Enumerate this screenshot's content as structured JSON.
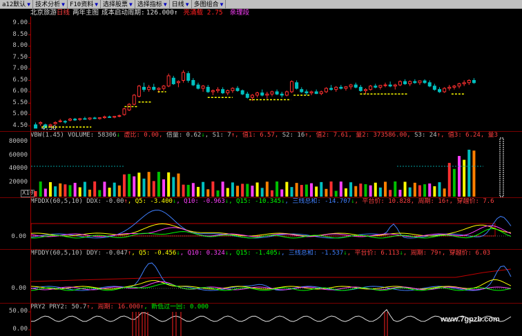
{
  "toolbar": {
    "items": [
      {
        "label": "a12默认"
      },
      {
        "label": "技术分析"
      },
      {
        "label": "F10资料"
      },
      {
        "label": "选择股票"
      },
      {
        "label": "选择指标"
      },
      {
        "label": "日线"
      },
      {
        "label": "多图组合"
      }
    ]
  },
  "info": {
    "stock_name": "北京旅游",
    "period": "日线",
    "ma_label": "两年主图",
    "cost_label": "成本启动周期:",
    "cost_value": "126.000↑",
    "red_text": "亮涌载 2.75",
    "magenta_text": "亲理段"
  },
  "main_chart": {
    "y_labels": [
      "9.00",
      "8.50",
      "8.00",
      "7.50",
      "7.00",
      "6.50",
      "6.00",
      "5.50",
      "5.00",
      "4.50"
    ],
    "low_marker": "4.30",
    "candles": [
      [
        4.55,
        4.65,
        4.45,
        4.4
      ],
      [
        4.6,
        4.7,
        4.5,
        4.65
      ],
      [
        4.55,
        4.6,
        4.4,
        4.42
      ],
      [
        4.5,
        4.6,
        4.45,
        4.55
      ],
      [
        4.6,
        4.7,
        4.55,
        4.65
      ],
      [
        4.7,
        4.8,
        4.65,
        4.72
      ],
      [
        4.7,
        4.75,
        4.6,
        4.68
      ],
      [
        4.75,
        4.85,
        4.7,
        4.8
      ],
      [
        4.8,
        4.85,
        4.72,
        4.76
      ],
      [
        4.78,
        4.85,
        4.72,
        4.82
      ],
      [
        4.82,
        4.9,
        4.78,
        4.8
      ],
      [
        4.8,
        4.88,
        4.75,
        4.85
      ],
      [
        4.85,
        4.9,
        4.8,
        4.82
      ],
      [
        4.82,
        4.88,
        4.78,
        4.86
      ],
      [
        4.86,
        4.95,
        4.82,
        4.9
      ],
      [
        4.9,
        4.95,
        4.85,
        4.88
      ],
      [
        4.88,
        4.94,
        4.84,
        4.92
      ],
      [
        4.92,
        5.0,
        4.88,
        4.95
      ],
      [
        5.0,
        5.3,
        4.95,
        5.25
      ],
      [
        5.2,
        5.5,
        5.15,
        5.45
      ],
      [
        5.45,
        5.9,
        5.4,
        5.85
      ],
      [
        5.8,
        6.3,
        5.75,
        6.25
      ],
      [
        6.2,
        6.4,
        6.0,
        6.1
      ],
      [
        6.1,
        6.3,
        6.0,
        6.2
      ],
      [
        6.2,
        6.35,
        6.05,
        6.1
      ],
      [
        6.1,
        6.2,
        5.95,
        6.15
      ],
      [
        6.15,
        6.3,
        6.05,
        6.25
      ],
      [
        6.25,
        6.8,
        6.2,
        6.7
      ],
      [
        6.6,
        6.7,
        6.3,
        6.35
      ],
      [
        6.4,
        6.5,
        6.2,
        6.45
      ],
      [
        6.5,
        6.95,
        6.4,
        6.85
      ],
      [
        6.8,
        6.9,
        6.4,
        6.5
      ],
      [
        6.5,
        6.6,
        6.25,
        6.3
      ],
      [
        6.3,
        6.4,
        6.1,
        6.15
      ],
      [
        6.15,
        6.3,
        6.0,
        6.25
      ],
      [
        6.2,
        6.3,
        5.95,
        6.0
      ],
      [
        6.0,
        6.1,
        5.85,
        6.05
      ],
      [
        6.05,
        6.2,
        5.95,
        6.1
      ],
      [
        6.1,
        6.2,
        5.9,
        5.95
      ],
      [
        5.95,
        6.1,
        5.85,
        6.05
      ],
      [
        6.05,
        6.2,
        5.95,
        6.15
      ],
      [
        6.15,
        6.25,
        6.0,
        6.05
      ],
      [
        6.05,
        6.1,
        5.85,
        5.9
      ],
      [
        5.9,
        6.0,
        5.7,
        5.75
      ],
      [
        5.75,
        5.9,
        5.6,
        5.85
      ],
      [
        5.85,
        6.0,
        5.75,
        5.95
      ],
      [
        5.95,
        6.1,
        5.8,
        5.85
      ],
      [
        5.85,
        6.0,
        5.7,
        5.9
      ],
      [
        5.9,
        6.05,
        5.8,
        6.0
      ],
      [
        6.0,
        6.1,
        5.85,
        5.9
      ],
      [
        5.9,
        6.0,
        5.75,
        5.85
      ],
      [
        5.85,
        6.05,
        5.8,
        6.0
      ],
      [
        6.0,
        6.5,
        5.95,
        6.45
      ],
      [
        6.4,
        6.5,
        6.1,
        6.15
      ],
      [
        6.1,
        6.2,
        5.95,
        6.0
      ],
      [
        6.0,
        6.1,
        5.85,
        5.95
      ],
      [
        5.95,
        6.05,
        5.85,
        6.0
      ],
      [
        6.0,
        6.1,
        5.9,
        5.92
      ],
      [
        5.92,
        6.05,
        5.85,
        6.0
      ],
      [
        6.0,
        6.2,
        5.95,
        6.15
      ],
      [
        6.15,
        6.3,
        6.05,
        6.1
      ],
      [
        6.1,
        6.25,
        6.0,
        6.2
      ],
      [
        6.2,
        6.3,
        6.1,
        6.15
      ],
      [
        6.15,
        6.25,
        6.05,
        6.22
      ],
      [
        6.22,
        6.35,
        6.1,
        6.3
      ],
      [
        6.3,
        6.4,
        6.15,
        6.2
      ],
      [
        6.2,
        6.3,
        6.0,
        6.05
      ],
      [
        6.05,
        6.15,
        5.9,
        6.1
      ],
      [
        6.1,
        6.3,
        6.05,
        6.25
      ],
      [
        6.25,
        6.35,
        6.15,
        6.2
      ],
      [
        6.2,
        6.3,
        6.1,
        6.28
      ],
      [
        6.28,
        6.4,
        6.2,
        6.3
      ],
      [
        6.3,
        6.45,
        6.2,
        6.25
      ],
      [
        6.25,
        6.35,
        6.1,
        6.3
      ],
      [
        6.3,
        6.5,
        6.25,
        6.45
      ],
      [
        6.45,
        6.55,
        6.3,
        6.35
      ],
      [
        6.35,
        6.5,
        6.25,
        6.45
      ],
      [
        6.45,
        6.55,
        6.35,
        6.4
      ],
      [
        6.4,
        6.5,
        6.3,
        6.48
      ],
      [
        6.48,
        6.55,
        6.35,
        6.4
      ],
      [
        6.4,
        6.5,
        6.2,
        6.25
      ],
      [
        6.25,
        6.35,
        6.05,
        6.1
      ],
      [
        6.1,
        6.2,
        5.95,
        6.0
      ],
      [
        6.0,
        6.2,
        5.95,
        6.15
      ],
      [
        6.15,
        6.3,
        6.05,
        6.2
      ],
      [
        6.2,
        6.3,
        6.1,
        6.25
      ],
      [
        6.25,
        6.4,
        6.15,
        6.35
      ],
      [
        6.35,
        6.5,
        6.25,
        6.4
      ],
      [
        6.4,
        6.55,
        6.3,
        6.5
      ],
      [
        6.5,
        6.6,
        6.35,
        6.4
      ]
    ],
    "support_lines": [
      {
        "x0": 0.03,
        "x1": 0.21,
        "y": 4.45
      },
      {
        "x0": 0.33,
        "x1": 0.38,
        "y": 5.35
      },
      {
        "x0": 0.38,
        "x1": 0.43,
        "y": 5.55
      },
      {
        "x0": 0.45,
        "x1": 0.48,
        "y": 6.0
      },
      {
        "x0": 0.63,
        "x1": 0.72,
        "y": 5.75
      },
      {
        "x0": 0.78,
        "x1": 0.93,
        "y": 5.65
      },
      {
        "x0": 0.94,
        "x1": 1.0,
        "y": 5.85
      },
      {
        "x0": 1.18,
        "x1": 1.35,
        "y": 5.9
      },
      {
        "x0": 1.51,
        "x1": 1.56,
        "y": 5.9
      }
    ]
  },
  "volume_panel": {
    "header": [
      {
        "t": "VBW(1.45) VOLUME: 58306",
        "c": "#c0c0c0"
      },
      {
        "t": "↓",
        "c": "#00c000"
      },
      {
        "t": " 虚比: 0.00,",
        "c": "#ff4040"
      },
      {
        "t": " 倍量: 0.62",
        "c": "#c0c0c0"
      },
      {
        "t": "↓",
        "c": "#00c000"
      },
      {
        "t": ", S1: 7",
        "c": "#c0c0c0"
      },
      {
        "t": "↑",
        "c": "#ff4040"
      },
      {
        "t": ", 值1: 6.57,",
        "c": "#ff4040"
      },
      {
        "t": " S2: 16",
        "c": "#c0c0c0"
      },
      {
        "t": "↑",
        "c": "#ff4040"
      },
      {
        "t": ", 值2: 7.61,",
        "c": "#ff4040"
      },
      {
        "t": " 量2: 373586.00,",
        "c": "#ff4040"
      },
      {
        "t": " S3: 24",
        "c": "#c0c0c0"
      },
      {
        "t": "↑",
        "c": "#ff4040"
      },
      {
        "t": ", 值3: 6.24,",
        "c": "#ff4040"
      },
      {
        "t": " 量3",
        "c": "#ff4040"
      }
    ],
    "y_labels": [
      "80000",
      "60000",
      "40000",
      "20000"
    ],
    "unit_label": "X10"
  },
  "ddx_panel": {
    "header": [
      {
        "t": "MFDDX(60,5,10) DDX: -0.00",
        "c": "#c0c0c0"
      },
      {
        "t": "↑",
        "c": "#ff4040"
      },
      {
        "t": ", Q5: -3.400",
        "c": "#ffff00"
      },
      {
        "t": "↓",
        "c": "#00c000"
      },
      {
        "t": ", Q10: -0.963",
        "c": "#ff40ff"
      },
      {
        "t": "↓",
        "c": "#00c000"
      },
      {
        "t": ", Q15: -10.345",
        "c": "#00ff00"
      },
      {
        "t": "↓",
        "c": "#00c000"
      },
      {
        "t": ", 三线总和: -14.707",
        "c": "#4080ff"
      },
      {
        "t": "↓",
        "c": "#00c000"
      },
      {
        "t": ", 平台价: 10.828,",
        "c": "#ff4040"
      },
      {
        "t": " 周期: 16",
        "c": "#ff4040"
      },
      {
        "t": "↑",
        "c": "#ff4040"
      },
      {
        "t": ", 穿越价: 7.6",
        "c": "#ff4040"
      }
    ],
    "y_label": "0.00"
  },
  "ddy_panel": {
    "header": [
      {
        "t": "MFDDY(60,5,10) DDY: -0.047",
        "c": "#c0c0c0"
      },
      {
        "t": "↑",
        "c": "#ff4040"
      },
      {
        "t": ", Q5: -0.456",
        "c": "#ffff00"
      },
      {
        "t": "↓",
        "c": "#00c000"
      },
      {
        "t": ", Q10: 0.324",
        "c": "#ff40ff"
      },
      {
        "t": "↓",
        "c": "#00c000"
      },
      {
        "t": ", Q15: -1.405",
        "c": "#00ff00"
      },
      {
        "t": "↓",
        "c": "#00c000"
      },
      {
        "t": ", 三线总和: -1.537",
        "c": "#4080ff"
      },
      {
        "t": "↓",
        "c": "#00c000"
      },
      {
        "t": ", 平台价: 6.113",
        "c": "#ff4040"
      },
      {
        "t": "↓",
        "c": "#00c000"
      },
      {
        "t": ", 周期: 79",
        "c": "#ff4040"
      },
      {
        "t": "↑",
        "c": "#ff4040"
      },
      {
        "t": ", 穿越价: 6.03",
        "c": "#ff4040"
      }
    ],
    "y_label": "0.00"
  },
  "pry_panel": {
    "header": [
      {
        "t": "PRY2 PRY2: 50.7",
        "c": "#c0c0c0"
      },
      {
        "t": "↑",
        "c": "#ff4040"
      },
      {
        "t": ", 周期: 16.000",
        "c": "#ff4040"
      },
      {
        "t": "↑",
        "c": "#ff4040"
      },
      {
        "t": ", 新低过一回: 0.000",
        "c": "#00ff00"
      }
    ],
    "y_labels": [
      "50.00",
      "0.00"
    ]
  },
  "watermark": "www.7gpzb.com",
  "colors": {
    "up": "#ff3030",
    "down": "#00c0c0",
    "green": "#00b000",
    "support": "#ffff00",
    "axis": "#a00000"
  }
}
